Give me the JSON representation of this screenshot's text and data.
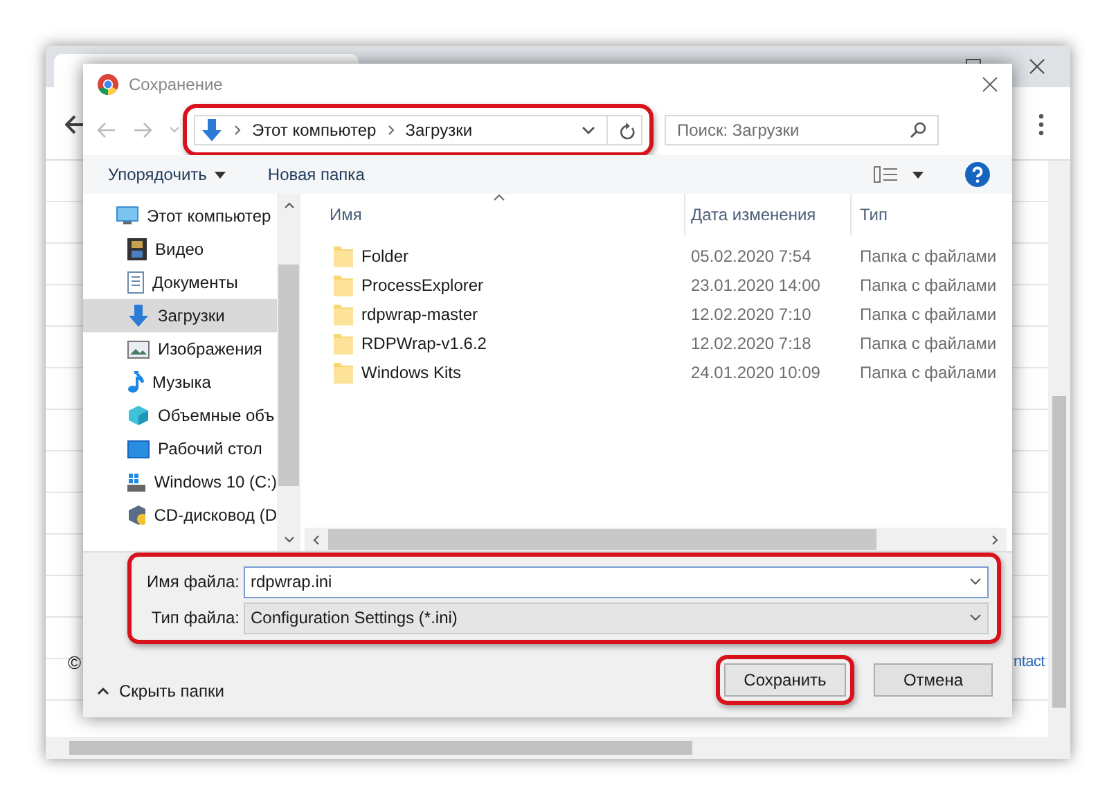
{
  "browser": {
    "footer_left": "©",
    "footer_link": "ntact"
  },
  "dialog": {
    "title": "Сохранение",
    "address": {
      "highlighted": true,
      "path": [
        "Этот компьютер",
        "Загрузки"
      ]
    },
    "search": {
      "placeholder": "Поиск: Загрузки"
    },
    "toolbar": {
      "organize": "Упорядочить",
      "new_folder": "Новая папка"
    },
    "sidebar": {
      "items": [
        {
          "label": "Этот компьютер",
          "kind": "computer",
          "selected": false,
          "children": [
            {
              "label": "Видео",
              "kind": "video",
              "selected": false
            },
            {
              "label": "Документы",
              "kind": "documents",
              "selected": false
            },
            {
              "label": "Загрузки",
              "kind": "downloads",
              "selected": true
            },
            {
              "label": "Изображения",
              "kind": "pictures",
              "selected": false
            },
            {
              "label": "Музыка",
              "kind": "music",
              "selected": false
            },
            {
              "label": "Объемные объ",
              "kind": "objects3d",
              "selected": false
            },
            {
              "label": "Рабочий стол",
              "kind": "desktop",
              "selected": false
            },
            {
              "label": "Windows 10 (C:)",
              "kind": "drive",
              "selected": false
            },
            {
              "label": "CD-дисковод (D",
              "kind": "cd",
              "selected": false
            }
          ]
        }
      ]
    },
    "table": {
      "columns": [
        "Имя",
        "Дата изменения",
        "Тип"
      ],
      "rows": [
        {
          "name": "Folder",
          "date": "05.02.2020 7:54",
          "type": "Папка с файлами"
        },
        {
          "name": "ProcessExplorer",
          "date": "23.01.2020 14:00",
          "type": "Папка с файлами"
        },
        {
          "name": "rdpwrap-master",
          "date": "12.02.2020 7:10",
          "type": "Папка с файлами"
        },
        {
          "name": "RDPWrap-v1.6.2",
          "date": "12.02.2020 7:18",
          "type": "Папка с файлами"
        },
        {
          "name": "Windows Kits",
          "date": "24.01.2020 10:09",
          "type": "Папка с файлами"
        }
      ]
    },
    "file_fields": {
      "highlighted": true,
      "name_label": "Имя файла:",
      "name_value": "rdpwrap.ini",
      "type_label": "Тип файла:",
      "type_value": "Configuration Settings (*.ini)"
    },
    "hide_folders": "Скрыть папки",
    "buttons": [
      {
        "label": "Сохранить",
        "kind": "primary",
        "highlighted": true
      },
      {
        "label": "Отмена",
        "kind": "normal",
        "highlighted": false
      }
    ]
  }
}
